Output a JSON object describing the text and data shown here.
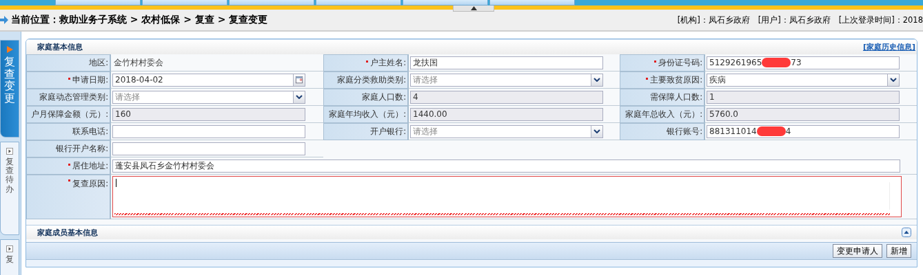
{
  "breadcrumb": "当前位置：救助业务子系统 > 农村低保 > 复查 > 复查变更",
  "user_info": [
    "[机构]：凤石乡政府",
    "[用户]：凤石乡政府",
    "[上次登录时间]：2018"
  ],
  "sidebar": {
    "items": [
      {
        "label": "复查变更",
        "selected": true
      },
      {
        "label": "复查待办",
        "selected": false
      },
      {
        "label": "复",
        "selected": false
      }
    ]
  },
  "family_info": {
    "title": "家庭基本信息",
    "history_link": "[家庭历史信息]",
    "fields": [
      {
        "label": "地区:",
        "required": false,
        "kind": "text",
        "value": "金竹村村委会"
      },
      {
        "label": "户主姓名:",
        "required": true,
        "kind": "input",
        "value": "龙扶国"
      },
      {
        "label": "身份证号码:",
        "required": true,
        "kind": "redacted",
        "value": "5129261965",
        "value_end": "73"
      },
      {
        "label": "申请日期:",
        "required": true,
        "kind": "date",
        "value": "2018-04-02"
      },
      {
        "label": "家庭分类救助类别:",
        "required": false,
        "kind": "select",
        "placeholder": "请选择"
      },
      {
        "label": "主要致贫原因:",
        "required": true,
        "kind": "select",
        "value": "疾病"
      },
      {
        "label": "家庭动态管理类别:",
        "required": false,
        "kind": "select",
        "placeholder": "请选择"
      },
      {
        "label": "家庭人口数:",
        "required": false,
        "kind": "readonly",
        "value": "4"
      },
      {
        "label": "需保障人口数:",
        "required": false,
        "kind": "readonly",
        "value": "1"
      },
      {
        "label": "户月保障金额（元）:",
        "required": false,
        "kind": "readonly",
        "value": "160"
      },
      {
        "label": "家庭年均收入（元）:",
        "required": false,
        "kind": "readonly",
        "value": "1440.00"
      },
      {
        "label": "家庭年总收入（元）:",
        "required": false,
        "kind": "readonly",
        "value": "5760.0"
      },
      {
        "label": "联系电话:",
        "required": false,
        "kind": "input"
      },
      {
        "label": "开户银行:",
        "required": false,
        "kind": "select",
        "placeholder": "请选择"
      },
      {
        "label": "银行账号:",
        "required": false,
        "kind": "redacted",
        "value": "881311014",
        "value_end": "4"
      },
      {
        "label": "银行开户名称:",
        "required": false,
        "kind": "input"
      },
      {
        "label": "居住地址:",
        "required": true,
        "kind": "wide",
        "value": "蓬安县凤石乡金竹村村委会"
      },
      {
        "label": "复查原因:",
        "required": true,
        "kind": "textarea",
        "invalid": true
      }
    ]
  },
  "members": {
    "title": "家庭成员基本信息",
    "buttons": [
      "变更申请人",
      "新增"
    ]
  }
}
